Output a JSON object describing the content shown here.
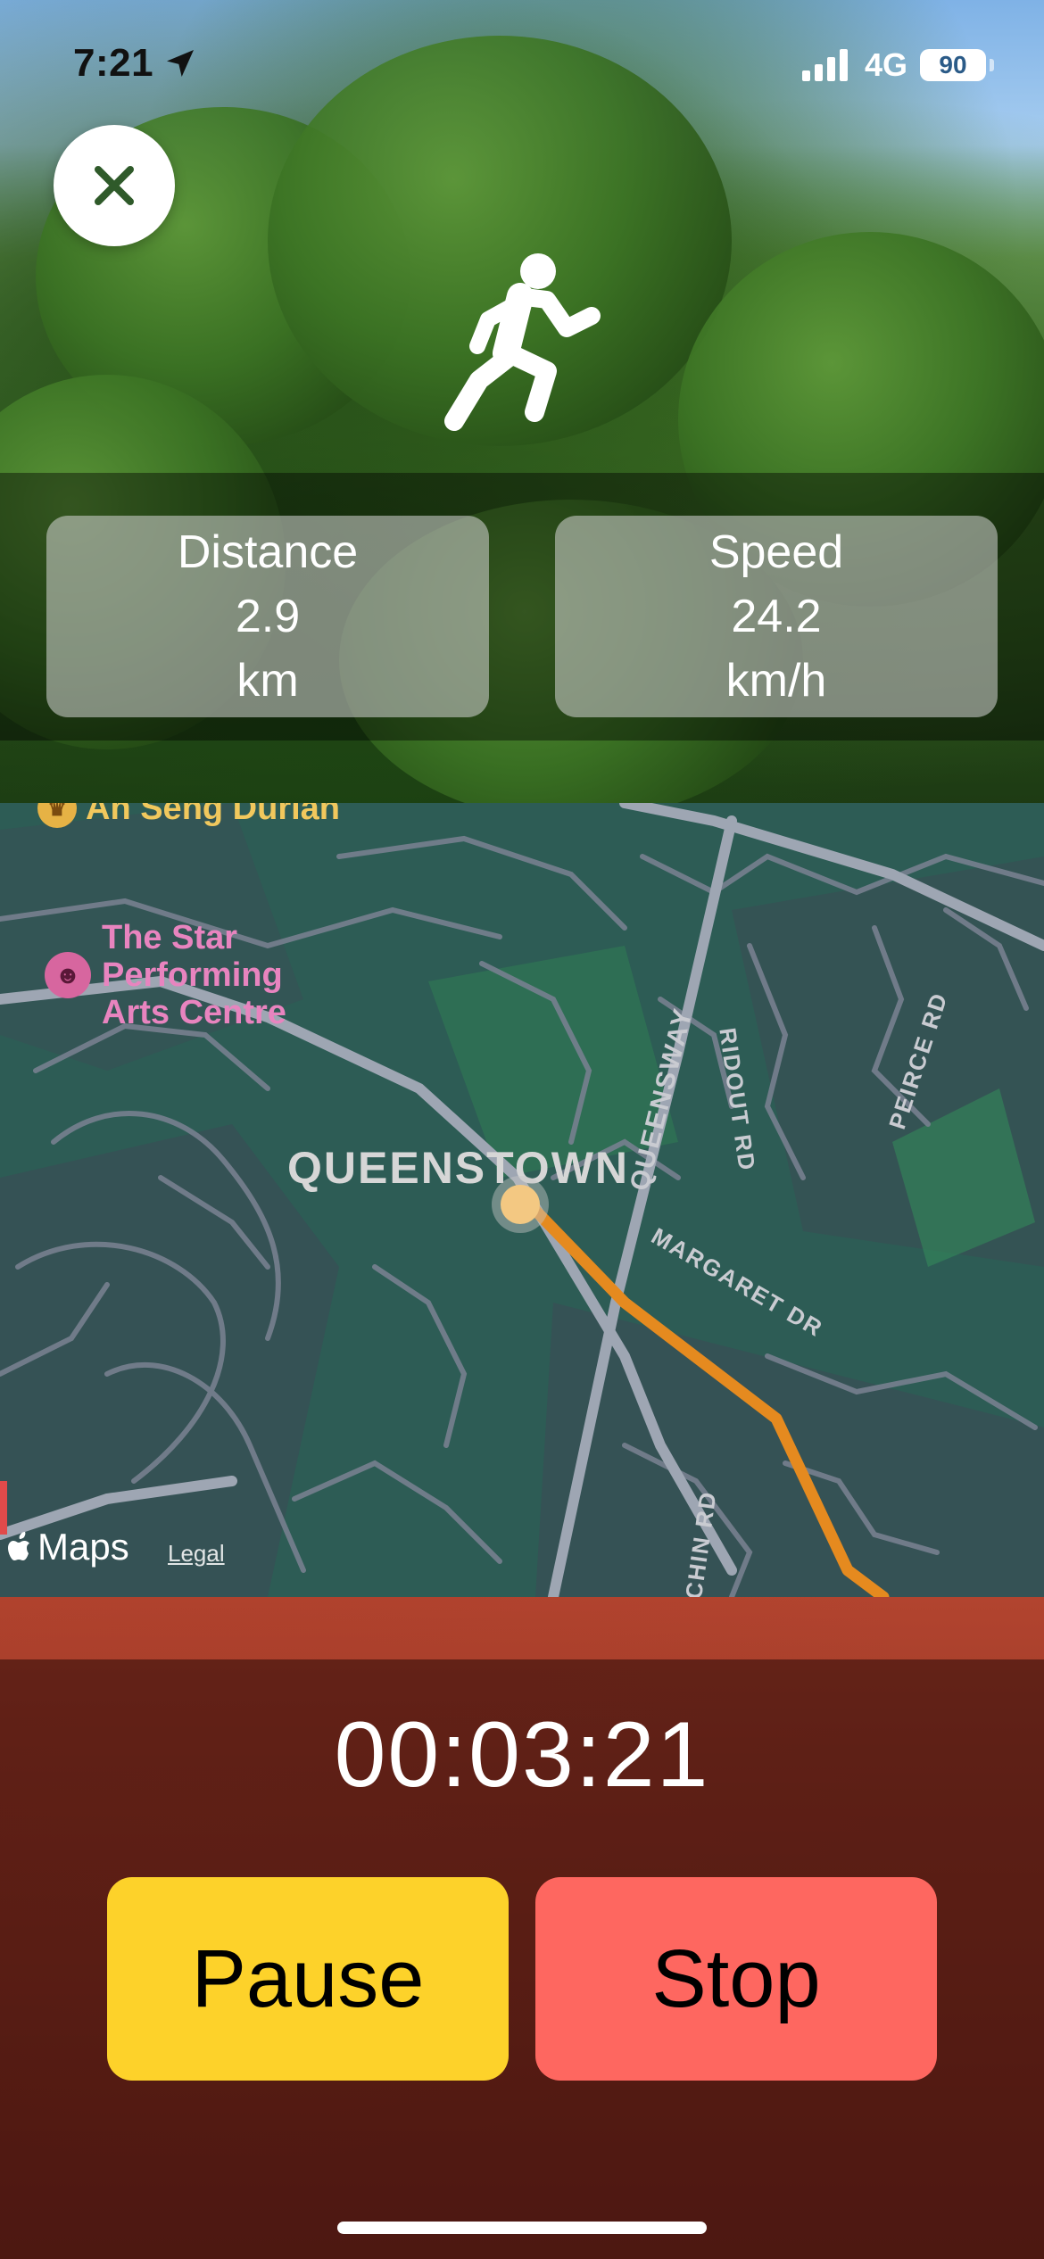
{
  "status_bar": {
    "time": "7:21",
    "network": "4G",
    "battery": "90",
    "icons": [
      "location-arrow-icon",
      "signal-icon",
      "battery-icon"
    ]
  },
  "header": {
    "close_icon": "close-icon",
    "activity_icon": "running-person-icon"
  },
  "stats": {
    "distance": {
      "title": "Distance",
      "value": "2.9",
      "unit": "km"
    },
    "speed": {
      "title": "Speed",
      "value": "24.2",
      "unit": "km/h"
    }
  },
  "map": {
    "poi_top": "An Seng Durian",
    "poi_theatre": [
      "The Star",
      "Performing",
      "Arts Centre"
    ],
    "area": "QUEENSTOWN",
    "roads": {
      "queensway": "QUEENSWAY",
      "ridout": "RIDOUT RD",
      "peirce": "PEIRCE RD",
      "margaret": "MARGARET DR",
      "chin": "CHIN RD"
    },
    "attribution": "Maps",
    "legal": "Legal",
    "colors": {
      "route": "#e58a1f",
      "position": "#f3c882"
    }
  },
  "workout": {
    "elapsed": "00:03:21",
    "pause_label": "Pause",
    "stop_label": "Stop"
  },
  "colors": {
    "pause": "#fdd22a",
    "stop": "#fe6760"
  }
}
